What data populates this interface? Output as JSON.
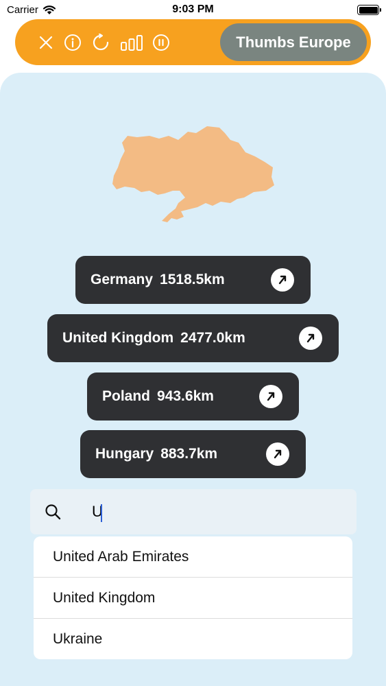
{
  "status_bar": {
    "carrier": "Carrier",
    "time": "9:03 PM"
  },
  "toolbar": {
    "icons": [
      "close-icon",
      "info-icon",
      "restart-icon",
      "stats-icon",
      "pause-icon"
    ],
    "game_title": "Thumbs Europe",
    "accent_color": "#f7a11f"
  },
  "map": {
    "shape_color": "#f3bb84"
  },
  "guesses": [
    {
      "country": "Germany",
      "distance": "1518.5km",
      "direction": "north-east"
    },
    {
      "country": "United Kingdom",
      "distance": "2477.0km",
      "direction": "north-east"
    },
    {
      "country": "Poland",
      "distance": "943.6km",
      "direction": "north-east"
    },
    {
      "country": "Hungary",
      "distance": "883.7km",
      "direction": "north-east"
    }
  ],
  "search": {
    "value": "U",
    "suggestions": [
      "United Arab Emirates",
      "United Kingdom",
      "Ukraine"
    ]
  }
}
